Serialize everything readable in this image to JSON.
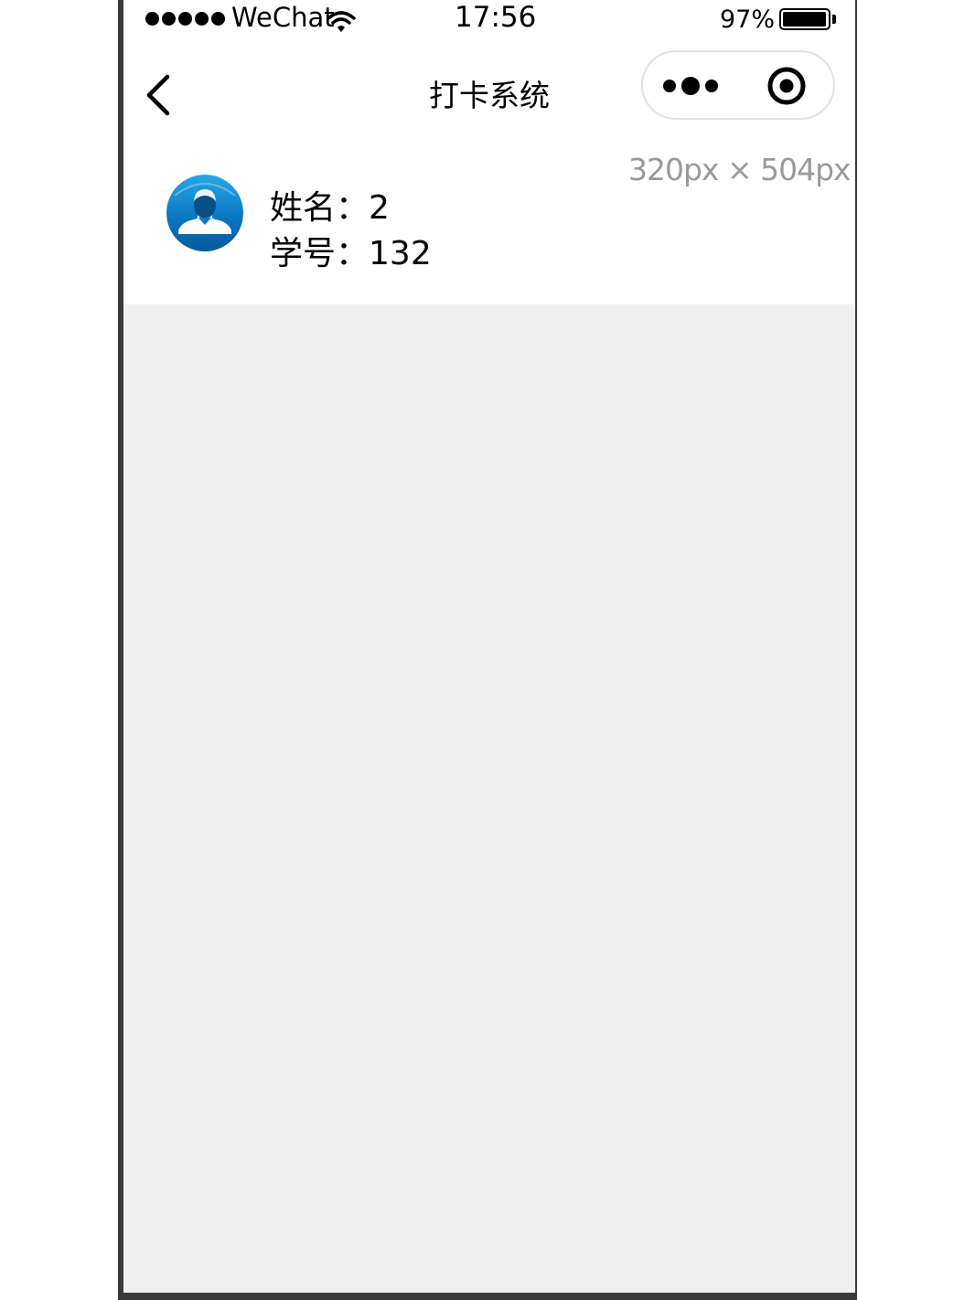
{
  "status_bar": {
    "carrier": "WeChat",
    "time": "17:56",
    "battery_percent_text": "97%",
    "battery_level": 0.97
  },
  "nav": {
    "title": "打卡系统",
    "back_icon": "chevron-left-icon",
    "more_icon": "more-dots-icon",
    "close_icon": "target-circle-icon"
  },
  "overlay": {
    "size_label": "320px × 504px"
  },
  "user": {
    "avatar_icon": "user-avatar-icon",
    "name_label": "姓名：",
    "name_value": "2",
    "id_label": "学号：",
    "id_value": "132"
  },
  "colors": {
    "page_background": "#f0f0f0",
    "header_background": "#ffffff",
    "avatar_blue": "#0a78c2"
  }
}
